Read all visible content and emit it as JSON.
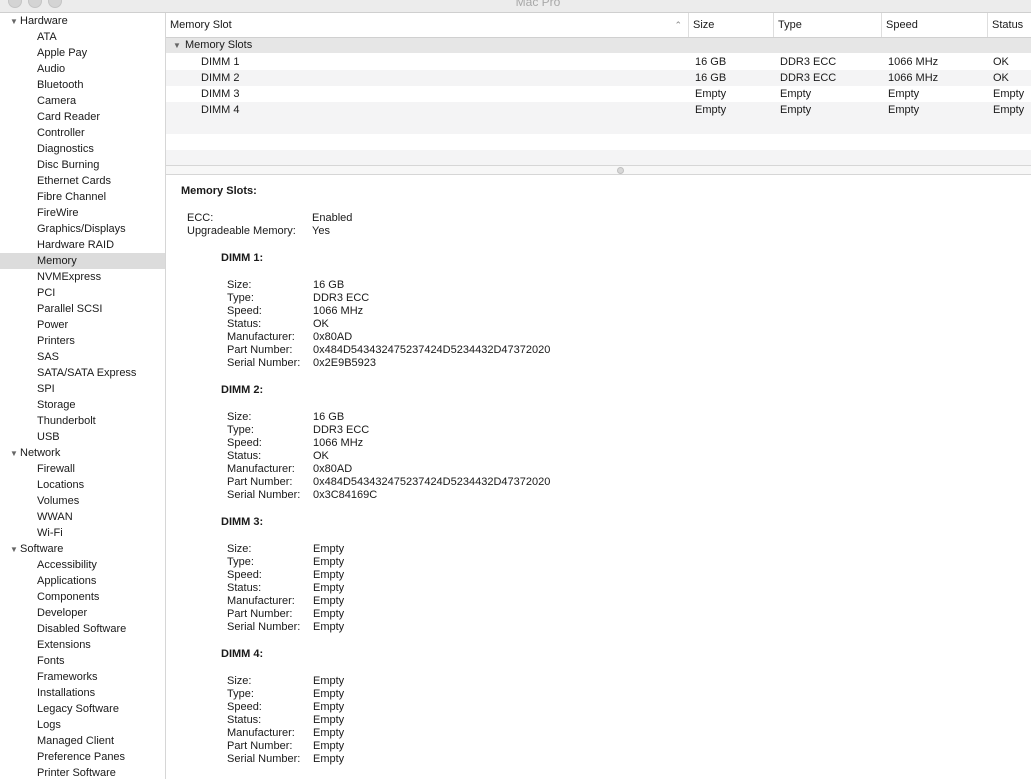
{
  "window": {
    "title": "Mac Pro"
  },
  "sidebar": {
    "categories": [
      {
        "label": "Hardware",
        "items": [
          "ATA",
          "Apple Pay",
          "Audio",
          "Bluetooth",
          "Camera",
          "Card Reader",
          "Controller",
          "Diagnostics",
          "Disc Burning",
          "Ethernet Cards",
          "Fibre Channel",
          "FireWire",
          "Graphics/Displays",
          "Hardware RAID",
          "Memory",
          "NVMExpress",
          "PCI",
          "Parallel SCSI",
          "Power",
          "Printers",
          "SAS",
          "SATA/SATA Express",
          "SPI",
          "Storage",
          "Thunderbolt",
          "USB"
        ]
      },
      {
        "label": "Network",
        "items": [
          "Firewall",
          "Locations",
          "Volumes",
          "WWAN",
          "Wi-Fi"
        ]
      },
      {
        "label": "Software",
        "items": [
          "Accessibility",
          "Applications",
          "Components",
          "Developer",
          "Disabled Software",
          "Extensions",
          "Fonts",
          "Frameworks",
          "Installations",
          "Legacy Software",
          "Logs",
          "Managed Client",
          "Preference Panes",
          "Printer Software"
        ]
      }
    ],
    "selected": "Memory"
  },
  "table": {
    "columns": [
      "Memory Slot",
      "Size",
      "Type",
      "Speed",
      "Status"
    ],
    "group": "Memory Slots",
    "rows": [
      [
        "DIMM 1",
        "16 GB",
        "DDR3 ECC",
        "1066 MHz",
        "OK"
      ],
      [
        "DIMM 2",
        "16 GB",
        "DDR3 ECC",
        "1066 MHz",
        "OK"
      ],
      [
        "DIMM 3",
        "Empty",
        "Empty",
        "Empty",
        "Empty"
      ],
      [
        "DIMM 4",
        "Empty",
        "Empty",
        "Empty",
        "Empty"
      ]
    ]
  },
  "detail": {
    "heading": "Memory Slots:",
    "summary": [
      {
        "key": "ECC:",
        "value": "Enabled"
      },
      {
        "key": "Upgradeable Memory:",
        "value": "Yes"
      }
    ],
    "dimms": [
      {
        "title": "DIMM 1:",
        "fields": [
          {
            "key": "Size:",
            "value": "16 GB"
          },
          {
            "key": "Type:",
            "value": "DDR3 ECC"
          },
          {
            "key": "Speed:",
            "value": "1066 MHz"
          },
          {
            "key": "Status:",
            "value": "OK"
          },
          {
            "key": "Manufacturer:",
            "value": "0x80AD"
          },
          {
            "key": "Part Number:",
            "value": "0x484D543432475237424D5234432D47372020"
          },
          {
            "key": "Serial Number:",
            "value": "0x2E9B5923"
          }
        ]
      },
      {
        "title": "DIMM 2:",
        "fields": [
          {
            "key": "Size:",
            "value": "16 GB"
          },
          {
            "key": "Type:",
            "value": "DDR3 ECC"
          },
          {
            "key": "Speed:",
            "value": "1066 MHz"
          },
          {
            "key": "Status:",
            "value": "OK"
          },
          {
            "key": "Manufacturer:",
            "value": "0x80AD"
          },
          {
            "key": "Part Number:",
            "value": "0x484D543432475237424D5234432D47372020"
          },
          {
            "key": "Serial Number:",
            "value": "0x3C84169C"
          }
        ]
      },
      {
        "title": "DIMM 3:",
        "fields": [
          {
            "key": "Size:",
            "value": "Empty"
          },
          {
            "key": "Type:",
            "value": "Empty"
          },
          {
            "key": "Speed:",
            "value": "Empty"
          },
          {
            "key": "Status:",
            "value": "Empty"
          },
          {
            "key": "Manufacturer:",
            "value": "Empty"
          },
          {
            "key": "Part Number:",
            "value": "Empty"
          },
          {
            "key": "Serial Number:",
            "value": "Empty"
          }
        ]
      },
      {
        "title": "DIMM 4:",
        "fields": [
          {
            "key": "Size:",
            "value": "Empty"
          },
          {
            "key": "Type:",
            "value": "Empty"
          },
          {
            "key": "Speed:",
            "value": "Empty"
          },
          {
            "key": "Status:",
            "value": "Empty"
          },
          {
            "key": "Manufacturer:",
            "value": "Empty"
          },
          {
            "key": "Part Number:",
            "value": "Empty"
          },
          {
            "key": "Serial Number:",
            "value": "Empty"
          }
        ]
      }
    ]
  }
}
